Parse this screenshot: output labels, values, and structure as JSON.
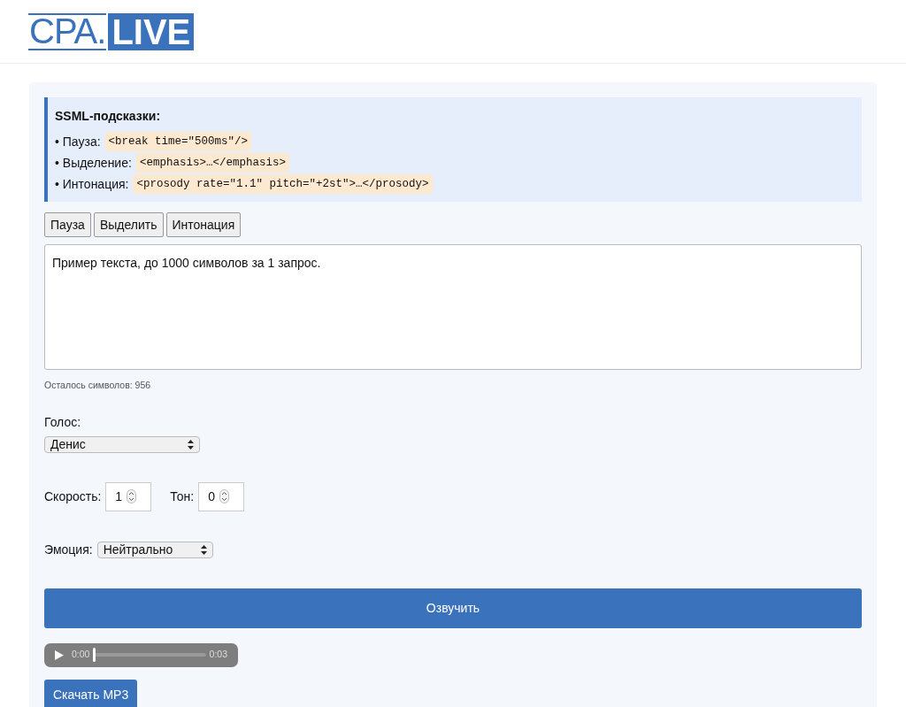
{
  "logo": {
    "left": "CPA.",
    "right": "LIVE"
  },
  "hints": {
    "title": "SSML-подсказки:",
    "items": [
      {
        "label": "• Пауза:",
        "code": "<break time=\"500ms\"/>"
      },
      {
        "label": "• Выделение:",
        "code": "<emphasis>…</emphasis>"
      },
      {
        "label": "• Интонация:",
        "code": "<prosody rate=\"1.1\" pitch=\"+2st\">…</prosody>"
      }
    ]
  },
  "insert_buttons": [
    "Пауза",
    "Выделить",
    "Интонация"
  ],
  "text_field": {
    "value": "Пример текста, до 1000 символов за 1 запрос."
  },
  "counter": "Осталось символов: 956",
  "voice": {
    "label": "Голос:",
    "value": "Денис"
  },
  "speed": {
    "label": "Скорость:",
    "value": "1"
  },
  "pitch": {
    "label": "Тон:",
    "value": "0"
  },
  "emotion": {
    "label": "Эмоция:",
    "value": "Нейтрально"
  },
  "speak_button": "Озвучить",
  "audio": {
    "current": "0:00",
    "duration": "0:03",
    "level": 0
  },
  "download_button": "Скачать MP3"
}
